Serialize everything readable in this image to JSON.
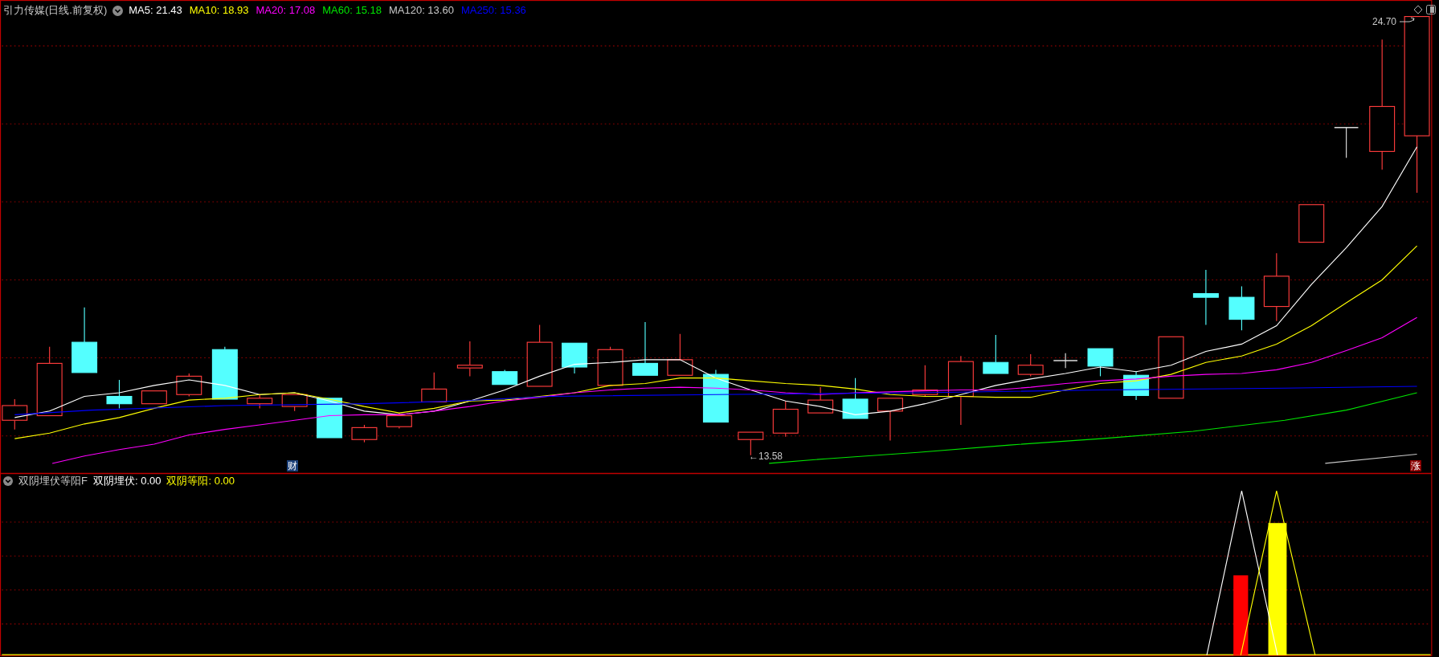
{
  "header": {
    "title": "引力传媒(日线.前复权)",
    "averages": [
      {
        "label": "MA5: 21.43",
        "color": "#ffffff"
      },
      {
        "label": "MA10: 18.93",
        "color": "#ffff00"
      },
      {
        "label": "MA20: 17.08",
        "color": "#ff00ff"
      },
      {
        "label": "MA60: 15.18",
        "color": "#00e600"
      },
      {
        "label": "MA120: 13.60",
        "color": "#c8c8c8"
      },
      {
        "label": "MA250: 15.36",
        "color": "#0000ff"
      }
    ]
  },
  "price_chart": {
    "high_label": "24.70",
    "low_label": "←13.58",
    "markers": [
      {
        "text": "财",
        "color": "#1a3f78"
      },
      {
        "text": "涨",
        "color": "#8b0000"
      }
    ]
  },
  "indicator": {
    "title": "双阴埋伏等阳F",
    "values": [
      {
        "label": "双阴埋伏: 0.00",
        "color": "#ffffff"
      },
      {
        "label": "双阴等阳: 0.00",
        "color": "#ffff00"
      }
    ]
  }
}
